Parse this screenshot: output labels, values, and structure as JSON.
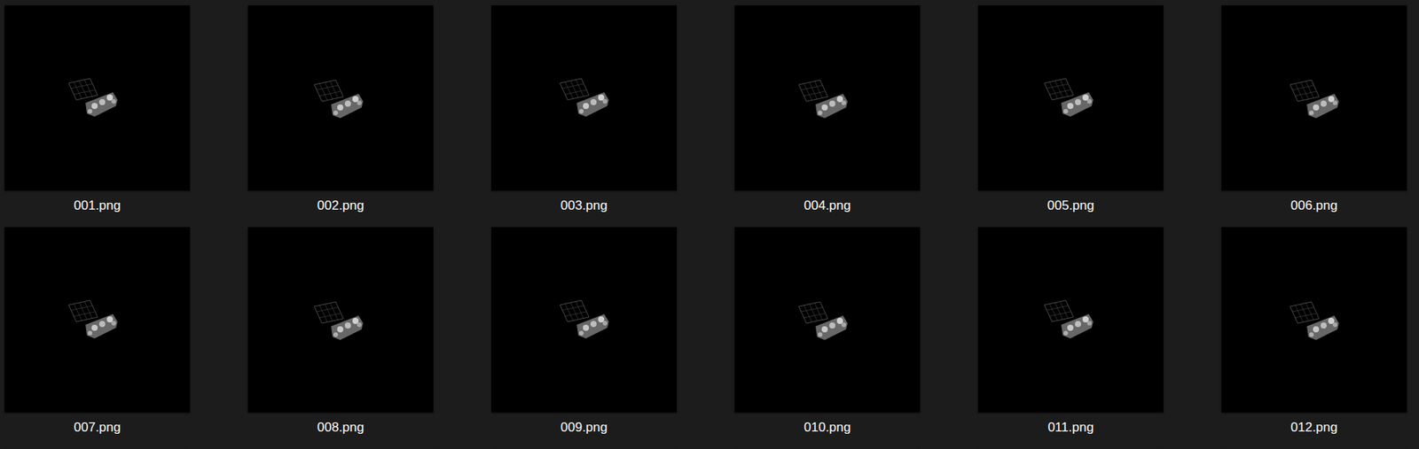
{
  "view": "large-icons",
  "items": [
    {
      "label": "001.png",
      "selected": false
    },
    {
      "label": "002.png",
      "selected": false
    },
    {
      "label": "003.png",
      "selected": false
    },
    {
      "label": "004.png",
      "selected": false
    },
    {
      "label": "005.png",
      "selected": false
    },
    {
      "label": "006.png",
      "selected": false
    },
    {
      "label": "007.png",
      "selected": false
    },
    {
      "label": "008.png",
      "selected": false
    },
    {
      "label": "009.png",
      "selected": false
    },
    {
      "label": "010.png",
      "selected": false
    },
    {
      "label": "011.png",
      "selected": false
    },
    {
      "label": "012.png",
      "selected": false
    },
    {
      "label": "",
      "selected": false
    },
    {
      "label": "",
      "selected": false
    },
    {
      "label": "",
      "selected": false
    },
    {
      "label": "",
      "selected": false
    },
    {
      "label": "",
      "selected": false
    },
    {
      "label": "",
      "selected": false
    }
  ]
}
